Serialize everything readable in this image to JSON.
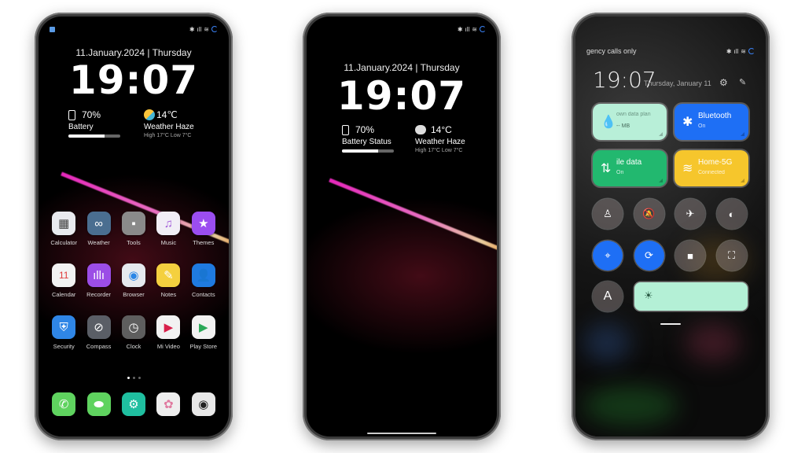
{
  "phone1": {
    "status": {
      "left_icon": "notification-square-icon",
      "right_icons": [
        "bluetooth-icon",
        "signal-icon",
        "wifi-icon",
        "sync-ring-icon"
      ]
    },
    "date": "11.January.2024 | Thursday",
    "time": "19:07",
    "battery": {
      "percent_label": "70%",
      "label": "Battery",
      "level": 0.7
    },
    "weather": {
      "temp": "14℃",
      "label": "Weather Haze",
      "range": "High 17°C  Low 7°C",
      "icon": "partly-sunny-icon"
    },
    "apps": [
      {
        "label": "Calculator",
        "icon": "calculator-icon",
        "color": "#e8eaee",
        "glyph": "▦"
      },
      {
        "label": "Weather",
        "icon": "weather-icon",
        "color": "#4a6e90",
        "glyph": "∞"
      },
      {
        "label": "Tools",
        "icon": "tools-folder-icon",
        "color": "#8a8a8a",
        "glyph": "▪"
      },
      {
        "label": "Music",
        "icon": "music-icon",
        "color": "#f1eef6",
        "glyph": "♫"
      },
      {
        "label": "Themes",
        "icon": "themes-star-icon",
        "color": "#9b4df0",
        "glyph": "★"
      },
      {
        "label": "Calendar",
        "icon": "calendar-icon",
        "color": "#f2f2f2",
        "glyph": "11"
      },
      {
        "label": "Recorder",
        "icon": "recorder-icon",
        "color": "#9b4de6",
        "glyph": "ıllı"
      },
      {
        "label": "Browser",
        "icon": "browser-compass-icon",
        "color": "#e6e9ee",
        "glyph": "◉"
      },
      {
        "label": "Notes",
        "icon": "notes-pencil-icon",
        "color": "#f4d03f",
        "glyph": "✎"
      },
      {
        "label": "Contacts",
        "icon": "contacts-icon",
        "color": "#1f7ae0",
        "glyph": "👤"
      },
      {
        "label": "Security",
        "icon": "security-shield-icon",
        "color": "#2f86e6",
        "glyph": "⛨"
      },
      {
        "label": "Compass",
        "icon": "compass-icon",
        "color": "#5a5e66",
        "glyph": "⊘"
      },
      {
        "label": "Clock",
        "icon": "clock-icon",
        "color": "#5e5e5e",
        "glyph": "◷"
      },
      {
        "label": "Mi Video",
        "icon": "video-play-icon",
        "color": "#f2f2f2",
        "glyph": "▶"
      },
      {
        "label": "Play Store",
        "icon": "play-store-icon",
        "color": "#f2f2f2",
        "glyph": "▶"
      }
    ],
    "page_dots": {
      "count": 3,
      "active": 0
    },
    "dock": [
      {
        "icon": "phone-icon",
        "color": "#5fd35f",
        "glyph": "✆"
      },
      {
        "icon": "messages-icon",
        "color": "#5fd35f",
        "glyph": "⬬"
      },
      {
        "icon": "settings-gear-icon",
        "color": "#1fbfa0",
        "glyph": "⚙"
      },
      {
        "icon": "gallery-icon",
        "color": "#eeeeee",
        "glyph": "✿"
      },
      {
        "icon": "camera-icon",
        "color": "#e8e8e8",
        "glyph": "◉"
      }
    ]
  },
  "phone2": {
    "status": {
      "right_icons": [
        "bluetooth-icon",
        "signal-icon",
        "wifi-icon",
        "sync-ring-icon"
      ]
    },
    "date": "11.January.2024 | Thursday",
    "time": "19:07",
    "battery": {
      "percent_label": "70%",
      "label": "Battery Status",
      "level": 0.7
    },
    "weather": {
      "temp": "14°C",
      "label": "Weather Haze",
      "range": "High 17°C  Low 7°C",
      "icon": "cloud-icon"
    }
  },
  "phone3": {
    "status": {
      "carrier_text": "gency calls only",
      "right_icons": [
        "bluetooth-icon",
        "signal-icon",
        "wifi-icon",
        "sync-ring-icon"
      ]
    },
    "time": "19:07",
    "date": "Thursday, January 11",
    "tiles": [
      {
        "title": "own data plan",
        "subtitle": "-- MB",
        "icon": "water-drop-icon",
        "glyph": "💧",
        "color": "#b8efd8",
        "text_color": "#2a4a3c"
      },
      {
        "title": "Bluetooth",
        "subtitle": "On",
        "icon": "bluetooth-icon",
        "glyph": "✱",
        "color": "#1e6ff5",
        "text_color": "#ffffff"
      },
      {
        "title": "ile data",
        "subtitle": "On",
        "icon": "mobile-data-arrows-icon",
        "glyph": "⇅",
        "color": "#22b86f",
        "text_color": "#ffffff"
      },
      {
        "title": "Home-5G",
        "subtitle": "Connected",
        "icon": "wifi-icon",
        "glyph": "≋",
        "color": "#f6c62c",
        "text_color": "#ffffff"
      }
    ],
    "round_buttons": [
      {
        "name": "flashlight",
        "glyph": "♙",
        "on": false
      },
      {
        "name": "mute",
        "glyph": "🔕",
        "on": false
      },
      {
        "name": "airplane-mode",
        "glyph": "✈",
        "on": false
      },
      {
        "name": "dark-mode",
        "glyph": "◐",
        "on": false
      },
      {
        "name": "location",
        "glyph": "⌖",
        "on": true
      },
      {
        "name": "rotation-lock",
        "glyph": "⟳",
        "on": true
      },
      {
        "name": "screen-record",
        "glyph": "■",
        "on": false
      },
      {
        "name": "screenshot-scan",
        "glyph": "⛶",
        "on": false
      }
    ],
    "auto_brightness": {
      "label": "A"
    },
    "brightness": {
      "icon": "sun-icon",
      "glyph": "☀"
    }
  }
}
